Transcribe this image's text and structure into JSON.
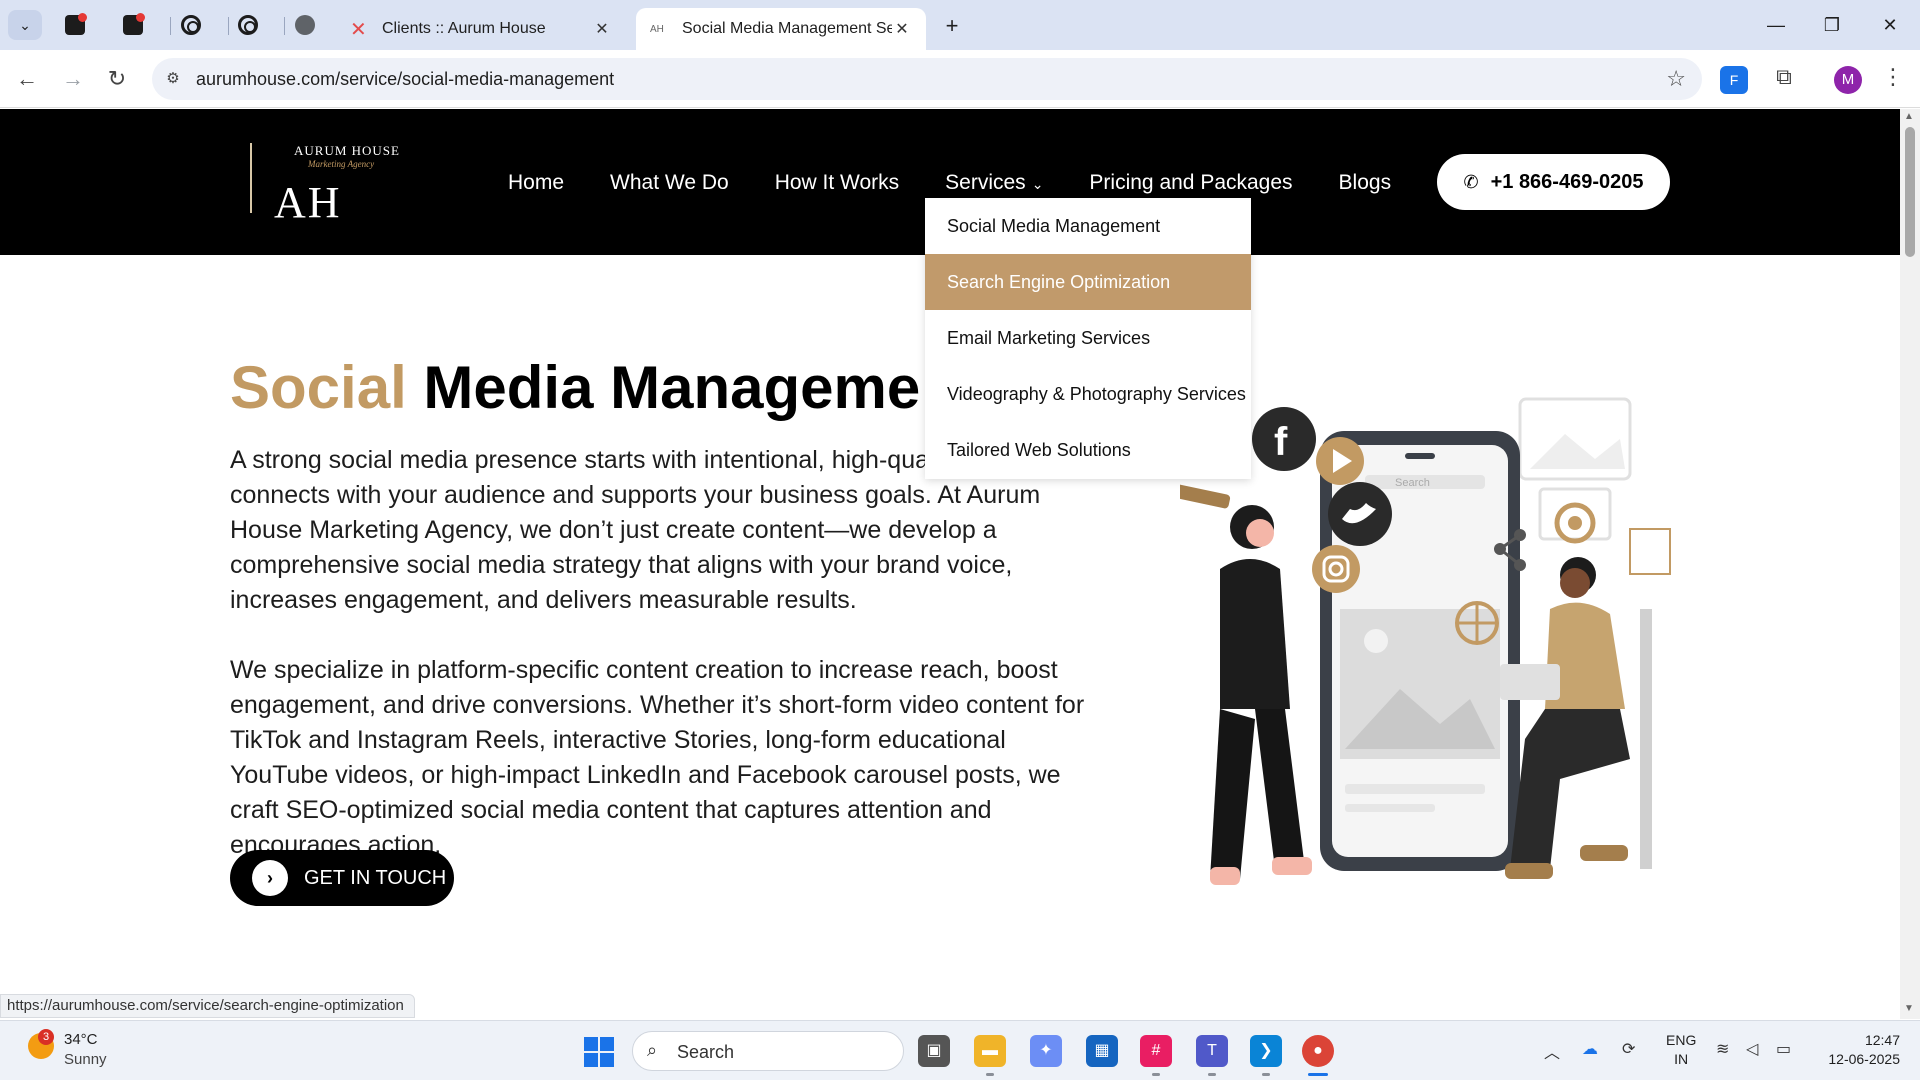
{
  "browser": {
    "tabs": [
      {
        "title": "Clients :: Aurum House",
        "close": "✕"
      },
      {
        "title": "Social Media Management Serv",
        "close": "✕"
      }
    ],
    "new_tab": "+",
    "window_controls": {
      "minimize": "—",
      "restore": "❐",
      "close": "✕"
    },
    "tab_menu": "⌄",
    "url": "aurumhouse.com/service/social-media-management",
    "extension_label": "F",
    "profile_initial": "M",
    "status_url": "https://aurumhouse.com/service/search-engine-optimization"
  },
  "site": {
    "brand_name": "AURUM HOUSE",
    "brand_tagline": "Marketing Agency",
    "brand_mark": "AH",
    "nav": {
      "home": "Home",
      "what_we_do": "What We Do",
      "how_it_works": "How It Works",
      "services": "Services",
      "pricing": "Pricing and Packages",
      "blogs": "Blogs"
    },
    "phone": "+1 866-469-0205",
    "services_menu": [
      "Social Media Management",
      "Search Engine Optimization",
      "Email Marketing Services",
      "Videography & Photography Services",
      "Tailored Web Solutions"
    ],
    "hero": {
      "title_accent": "Social",
      "title_rest": "Media Manageme",
      "paragraph1": "A strong social media presence starts with intentional, high-qua creation that connects with your audience and supports your business goals. At Aurum House Marketing Agency, we don’t just create content—we develop a comprehensive social media strategy that aligns with your brand voice, increases engagement, and delivers measurable results.",
      "paragraph2": "We specialize in platform-specific content creation to increase reach, boost engagement, and drive conversions. Whether it’s short-form video content for TikTok and Instagram Reels, interactive Stories, long-form educational YouTube videos, or high-impact LinkedIn and Facebook carousel posts, we craft SEO-optimized social media content that captures attention and encourages action.",
      "cta": "GET IN TOUCH"
    },
    "illustration_search": "Search",
    "colors": {
      "accent": "#c29a63",
      "header_bg": "#000000",
      "dropdown_hover": "#c19a6b"
    }
  },
  "taskbar": {
    "weather_temp": "34°C",
    "weather_condition": "Sunny",
    "weather_badge": "3",
    "search_label": "Search",
    "language": "ENG",
    "region": "IN",
    "time": "12:47",
    "date": "12-06-2025"
  }
}
